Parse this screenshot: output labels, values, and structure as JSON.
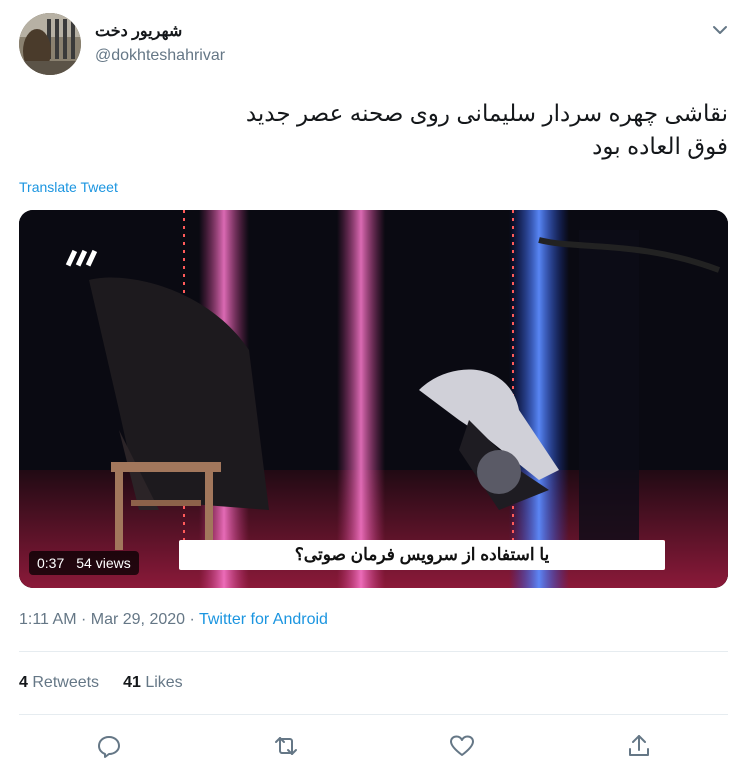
{
  "user": {
    "display_name": "شهریور دخت",
    "handle": "@dokhteshahrivar"
  },
  "tweet": {
    "text_line1": "نقاشی چهره سردار سلیمانی روی صحنه عصر جدید",
    "text_line2": "فوق العاده بود",
    "translate_label": "Translate Tweet"
  },
  "media": {
    "duration": "0:37",
    "views": "54 views",
    "caption": "یا استفاده از سرویس فرمان صوتی؟"
  },
  "meta": {
    "time": "1:11 AM",
    "separator": "·",
    "date": "Mar 29, 2020",
    "separator2": "·",
    "source": "Twitter for Android"
  },
  "stats": {
    "retweets_count": "4",
    "retweets_label": "Retweets",
    "likes_count": "41",
    "likes_label": "Likes"
  },
  "icons": {
    "menu": "chevron-down-icon",
    "reply": "reply-icon",
    "retweet": "retweet-icon",
    "like": "heart-icon",
    "share": "share-icon"
  },
  "colors": {
    "link": "#1b95e0",
    "muted": "#657786",
    "caption_red": "#d8152d"
  }
}
